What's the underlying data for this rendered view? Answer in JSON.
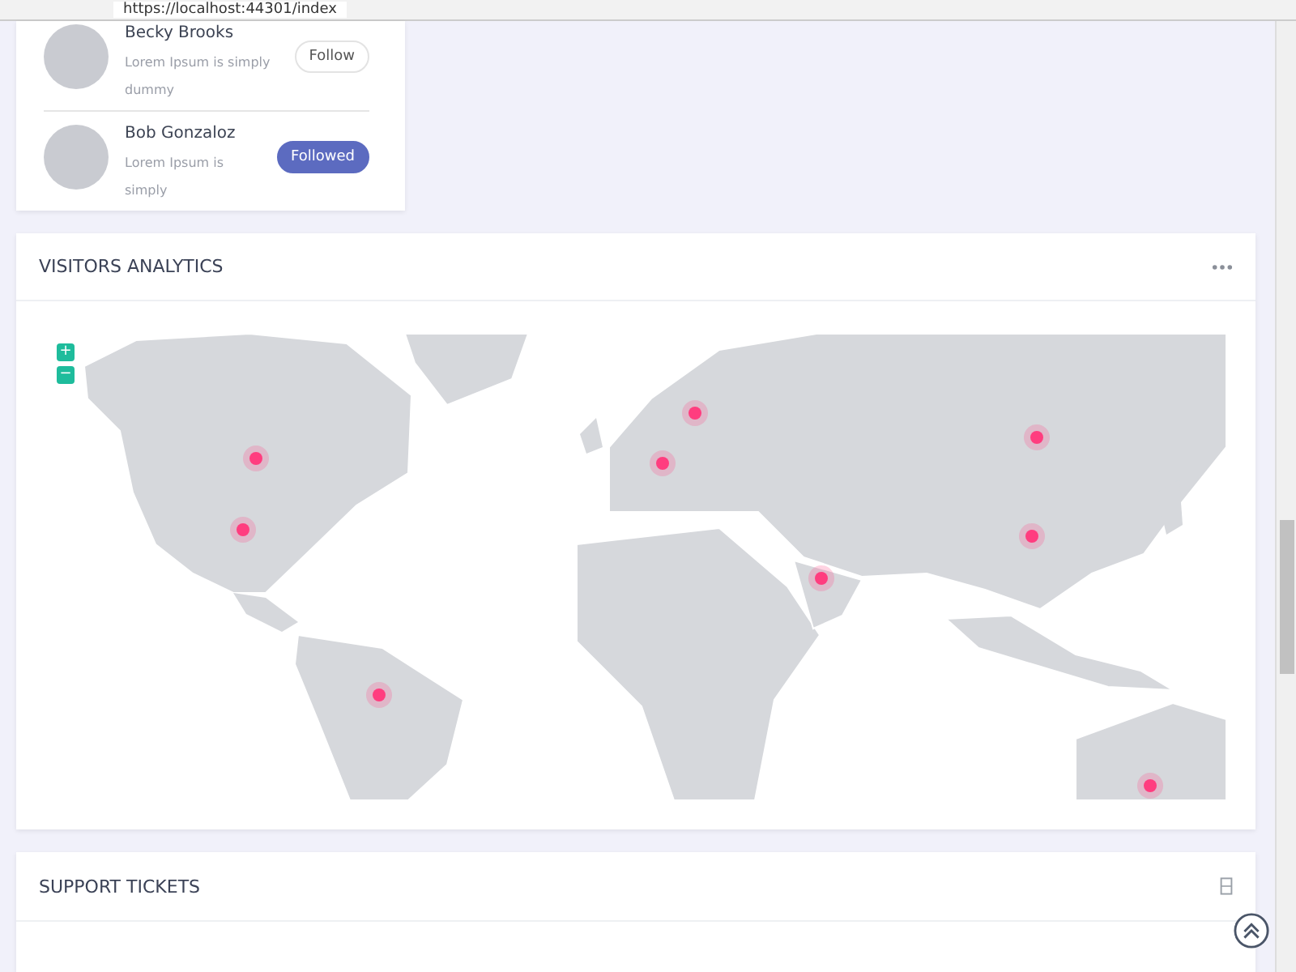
{
  "browser": {
    "url": "https://localhost:44301/index"
  },
  "people": [
    {
      "name": "Becky Brooks",
      "text": "Lorem Ipsum is simply dummy",
      "button": "Follow",
      "followed": false
    },
    {
      "name": "Bob Gonzaloz",
      "text": "Lorem Ipsum is simply",
      "button": "Followed",
      "followed": true
    }
  ],
  "analytics": {
    "title": "VISITORS ANALYTICS",
    "zoom_in": "+",
    "zoom_out": "−"
  },
  "support": {
    "title": "SUPPORT TICKETS"
  }
}
